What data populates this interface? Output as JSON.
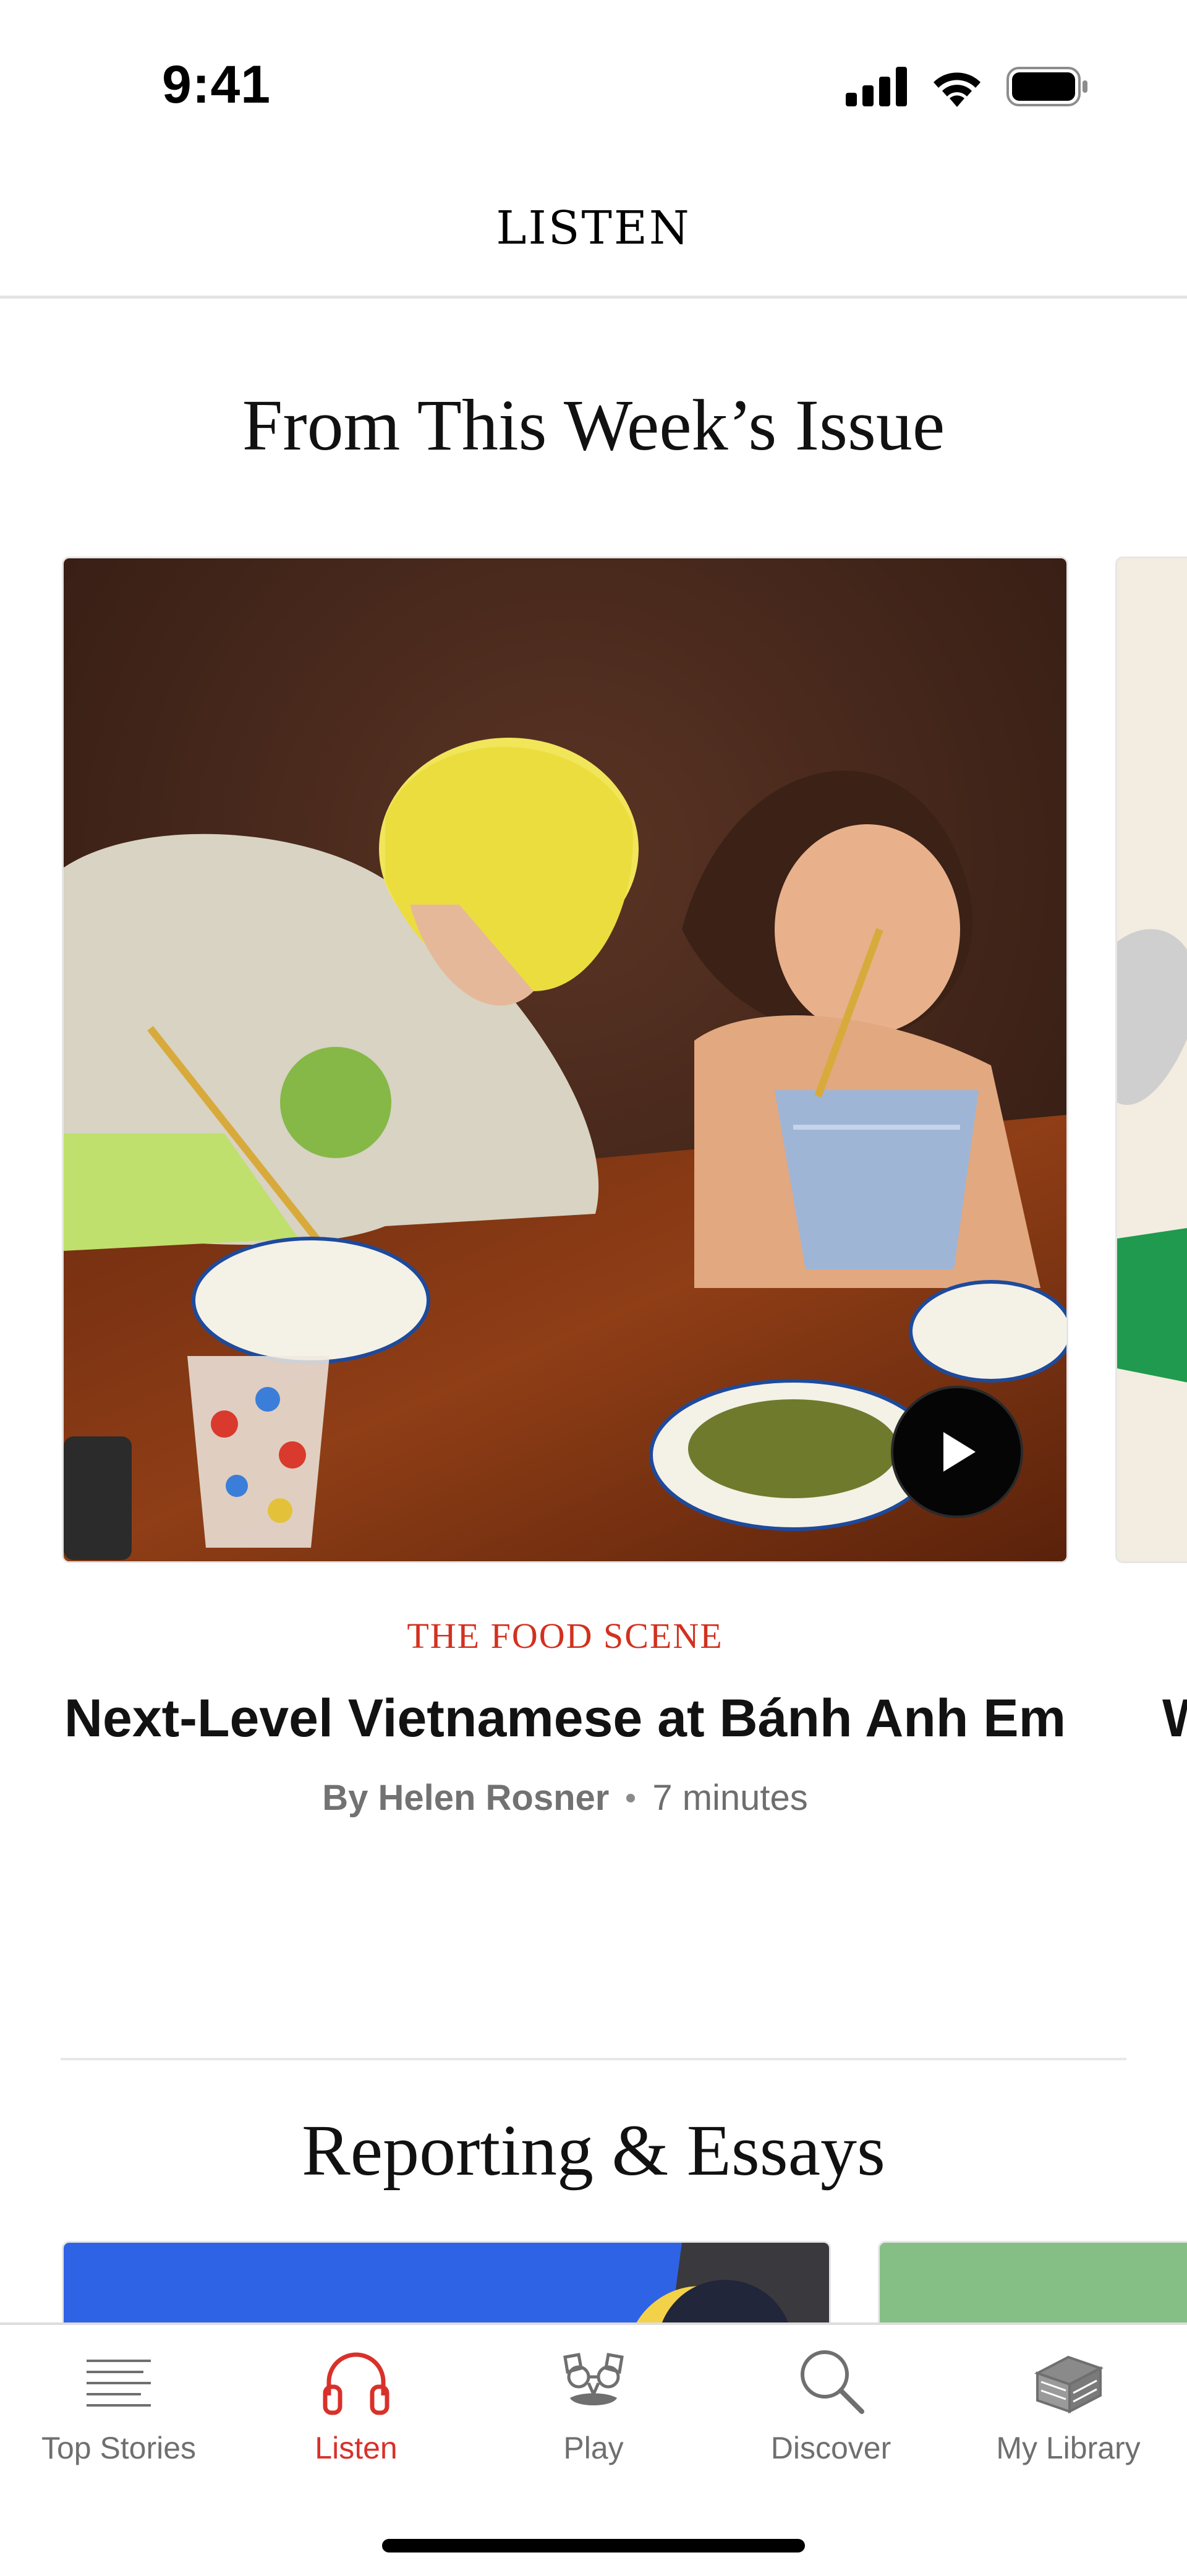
{
  "status_bar": {
    "time": "9:41"
  },
  "header": {
    "title": "LISTEN"
  },
  "section_issue": {
    "title": "From This Week’s Issue",
    "card": {
      "rubric": "THE FOOD SCENE",
      "title": "Next-Level Vietnamese at Bánh Anh Em",
      "author": "By Helen Rosner",
      "duration": "7 minutes",
      "icons": [
        "play-icon"
      ]
    },
    "peek_card_title_fragment": "W"
  },
  "section_reporting": {
    "title": "Reporting & Essays"
  },
  "tab_bar": {
    "active": "Listen",
    "accent_color": "#d8312a",
    "items": [
      {
        "label": "Top Stories",
        "icon": "lines-icon"
      },
      {
        "label": "Listen",
        "icon": "headphones-icon"
      },
      {
        "label": "Play",
        "icon": "mask-icon"
      },
      {
        "label": "Discover",
        "icon": "search-icon"
      },
      {
        "label": "My Library",
        "icon": "library-icon"
      }
    ]
  }
}
